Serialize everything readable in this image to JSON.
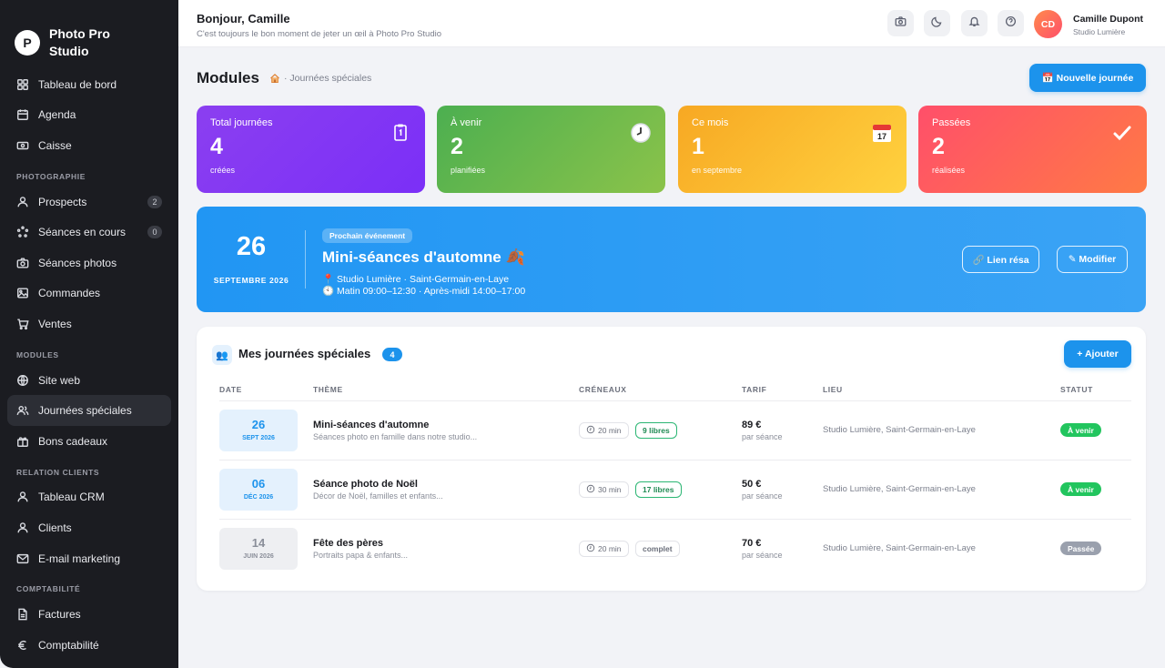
{
  "brand": {
    "initial": "P",
    "name": "Photo Pro Studio"
  },
  "sidebar": {
    "top": [
      {
        "label": "Tableau de bord",
        "icon": "grid-icon"
      },
      {
        "label": "Agenda",
        "icon": "calendar-icon"
      },
      {
        "label": "Caisse",
        "icon": "cash-icon"
      }
    ],
    "sections": [
      {
        "title": "PHOTOGRAPHIE",
        "items": [
          {
            "label": "Prospects",
            "icon": "user-icon",
            "badge": "2"
          },
          {
            "label": "Séances en cours",
            "icon": "spinner-icon",
            "badge": "0"
          },
          {
            "label": "Séances photos",
            "icon": "camera-icon"
          },
          {
            "label": "Commandes",
            "icon": "image-icon"
          },
          {
            "label": "Ventes",
            "icon": "cart-icon"
          }
        ]
      },
      {
        "title": "MODULES",
        "items": [
          {
            "label": "Site web",
            "icon": "globe-icon"
          },
          {
            "label": "Journées spéciales",
            "icon": "users-icon",
            "active": true
          },
          {
            "label": "Bons cadeaux",
            "icon": "gift-icon"
          }
        ]
      },
      {
        "title": "RELATION CLIENTS",
        "items": [
          {
            "label": "Tableau CRM",
            "icon": "user-icon"
          },
          {
            "label": "Clients",
            "icon": "user-icon"
          },
          {
            "label": "E-mail marketing",
            "icon": "mail-icon"
          }
        ]
      },
      {
        "title": "COMPTABILITÉ",
        "items": [
          {
            "label": "Factures",
            "icon": "file-icon"
          },
          {
            "label": "Comptabilité",
            "icon": "euro-icon"
          }
        ]
      }
    ]
  },
  "header": {
    "greeting": "Bonjour, Camille",
    "subtitle": "C'est toujours le bon moment de jeter un œil à Photo Pro Studio",
    "buttons": [
      "camera-icon",
      "moon-icon",
      "bell-icon",
      "help-icon"
    ],
    "avatar_initials": "CD",
    "user_name": "Camille Dupont",
    "user_org": "Studio Lumière"
  },
  "page": {
    "title": "Modules",
    "breadcrumb": "· Journées spéciales",
    "new_button": "📅 Nouvelle journée"
  },
  "stats": [
    {
      "label": "Total journées",
      "value": "4",
      "sub": "créées",
      "icon": "clipboard-icon",
      "color": "#8b3ff0"
    },
    {
      "label": "À venir",
      "value": "2",
      "sub": "planifiées",
      "icon": "clock-icon",
      "color": "#5cb85c"
    },
    {
      "label": "Ce mois",
      "value": "1",
      "sub": "en septembre",
      "icon": "calendar-icon",
      "color": "#f7b733"
    },
    {
      "label": "Passées",
      "value": "2",
      "sub": "réalisées",
      "icon": "check-icon",
      "color": "#ff4f6a"
    }
  ],
  "next_event": {
    "day": "26",
    "month": "SEPTEMBRE 2026",
    "pill": "Prochain événement",
    "title": "Mini-séances d'automne 🍂",
    "location": "📍 Studio Lumière · Saint-Germain-en-Laye",
    "time": "🕙 Matin 09:00–12:30 · Après-midi 14:00–17:00",
    "link_button": "🔗 Lien résa",
    "edit_button": "✎ Modifier"
  },
  "table": {
    "title": "Mes journées spéciales",
    "count": "4",
    "add_button": "+ Ajouter",
    "columns": [
      "DATE",
      "THÈME",
      "CRÉNEAUX",
      "TARIF",
      "LIEU",
      "STATUT"
    ],
    "rows": [
      {
        "day": "26",
        "month": "SEPT 2026",
        "title": "Mini-séances d'automne",
        "desc": "Séances photo en famille dans notre studio...",
        "duration": "20 min",
        "slots": "9 libres",
        "slots_type": "free",
        "price": "89 €",
        "price_sub": "par séance",
        "place": "Studio Lumière, Saint-Germain-en-Laye",
        "status": "À venir",
        "status_type": "up"
      },
      {
        "day": "06",
        "month": "DÉC 2026",
        "title": "Séance photo de Noël",
        "desc": "Décor de Noël, familles et enfants...",
        "duration": "30 min",
        "slots": "17 libres",
        "slots_type": "free",
        "price": "50 €",
        "price_sub": "par séance",
        "place": "Studio Lumière, Saint-Germain-en-Laye",
        "status": "À venir",
        "status_type": "up"
      },
      {
        "day": "14",
        "month": "JUIN 2026",
        "title": "Fête des pères",
        "desc": "Portraits papa & enfants...",
        "duration": "20 min",
        "slots": "complet",
        "slots_type": "full",
        "price": "70 €",
        "price_sub": "par séance",
        "place": "Studio Lumière, Saint-Germain-en-Laye",
        "status": "Passée",
        "status_type": "done"
      }
    ]
  }
}
